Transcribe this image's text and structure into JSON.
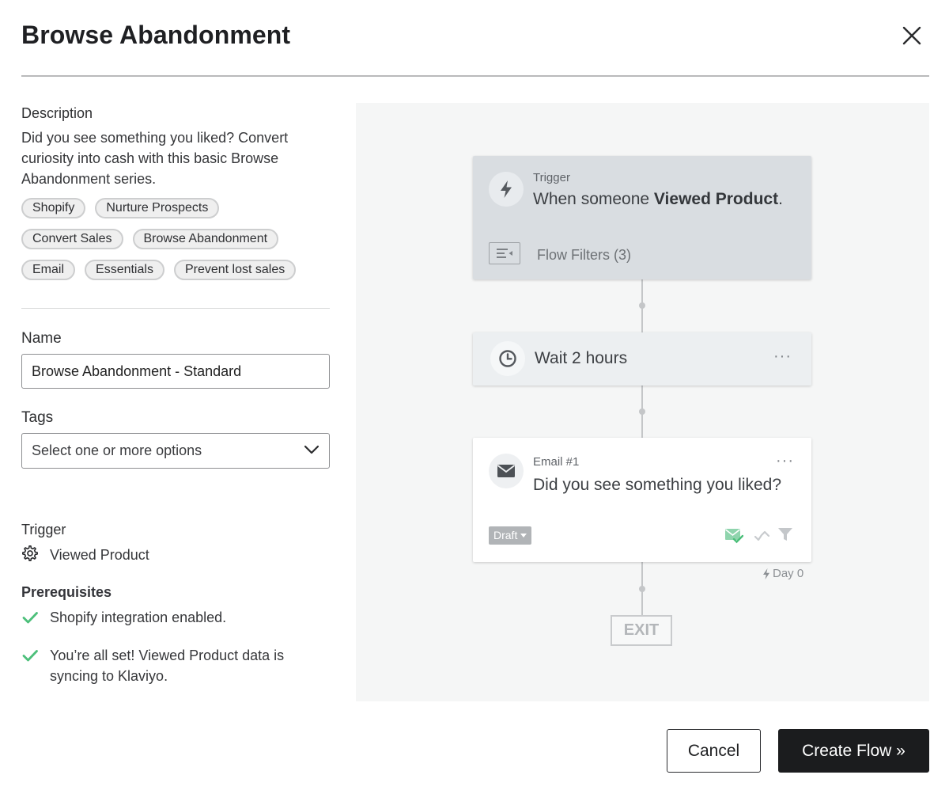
{
  "modal": {
    "title": "Browse Abandonment"
  },
  "description": {
    "label": "Description",
    "text": "Did you see something you liked? Convert curiosity into cash with this basic Browse Abandonment series.",
    "tags": [
      "Shopify",
      "Nurture Prospects",
      "Convert Sales",
      "Browse Abandonment",
      "Email",
      "Essentials",
      "Prevent lost sales"
    ]
  },
  "form": {
    "name_label": "Name",
    "name_value": "Browse Abandonment - Standard",
    "tags_label": "Tags",
    "tags_placeholder": "Select one or more options"
  },
  "trigger": {
    "label": "Trigger",
    "value": "Viewed Product"
  },
  "prerequisites": {
    "label": "Prerequisites",
    "items": [
      "Shopify integration enabled.",
      "You’re all set! Viewed Product data is syncing to Klaviyo."
    ]
  },
  "flow": {
    "trigger_card": {
      "label": "Trigger",
      "text_prefix": "When someone ",
      "text_bold": "Viewed Product",
      "text_suffix": ".",
      "filters": "Flow Filters (3)"
    },
    "wait_card": {
      "text": "Wait 2 hours",
      "more": "···"
    },
    "email_card": {
      "label": "Email #1",
      "subject": "Did you see something you liked?",
      "status": "Draft",
      "more": "···"
    },
    "day_label": "Day 0",
    "exit_label": "EXIT"
  },
  "actions": {
    "cancel": "Cancel",
    "create": "Create Flow »"
  },
  "colors": {
    "check_green": "#4cbf7a",
    "primary_button": "#1b1c1e"
  }
}
